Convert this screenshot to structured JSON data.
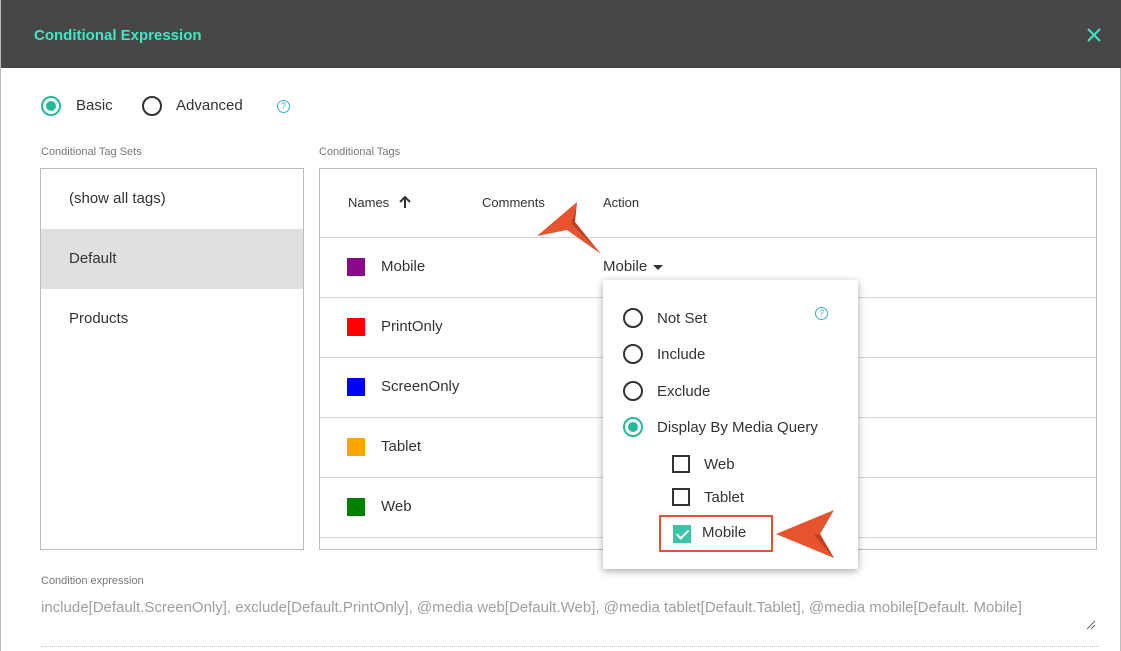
{
  "dialog": {
    "title": "Conditional Expression"
  },
  "mode": {
    "basic_label": "Basic",
    "advanced_label": "Advanced",
    "selected": "Basic",
    "help_glyph": "?"
  },
  "sets": {
    "label": "Conditional Tag Sets",
    "items": [
      {
        "label": "(show all tags)",
        "selected": false
      },
      {
        "label": "Default",
        "selected": true
      },
      {
        "label": "Products",
        "selected": false
      }
    ]
  },
  "tags": {
    "label": "Conditional Tags",
    "columns": {
      "names": "Names",
      "comments": "Comments",
      "action": "Action"
    },
    "rows": [
      {
        "name": "Mobile",
        "color": "#8b0a8b",
        "action": "Mobile"
      },
      {
        "name": "PrintOnly",
        "color": "#ff0000",
        "action": ""
      },
      {
        "name": "ScreenOnly",
        "color": "#0000ff",
        "action": ""
      },
      {
        "name": "Tablet",
        "color": "#ffa500",
        "action": ""
      },
      {
        "name": "Web",
        "color": "#008000",
        "action": ""
      }
    ]
  },
  "action_menu": {
    "options": [
      {
        "label": "Not Set",
        "selected": false
      },
      {
        "label": "Include",
        "selected": false
      },
      {
        "label": "Exclude",
        "selected": false
      },
      {
        "label": "Display By Media Query",
        "selected": true
      }
    ],
    "media": [
      {
        "label": "Web",
        "checked": false
      },
      {
        "label": "Tablet",
        "checked": false
      },
      {
        "label": "Mobile",
        "checked": true
      }
    ],
    "help_glyph": "?"
  },
  "condition": {
    "label": "Condition expression",
    "text": "include[Default.ScreenOnly], exclude[Default.PrintOnly], @media web[Default.Web], @media tablet[Default.Tablet], @media mobile[Default. Mobile]"
  },
  "colors": {
    "titlebar": "#474747",
    "title_text": "#3ee8c4",
    "accent": "#26b99a",
    "callout": "#e5532f"
  },
  "icons": {
    "close": "close-icon",
    "sort": "arrow-up-icon",
    "dropdown": "caret-down-icon",
    "help": "question-circle-icon",
    "resize": "resize-handle-icon",
    "callout": "callout-arrow-icon"
  }
}
